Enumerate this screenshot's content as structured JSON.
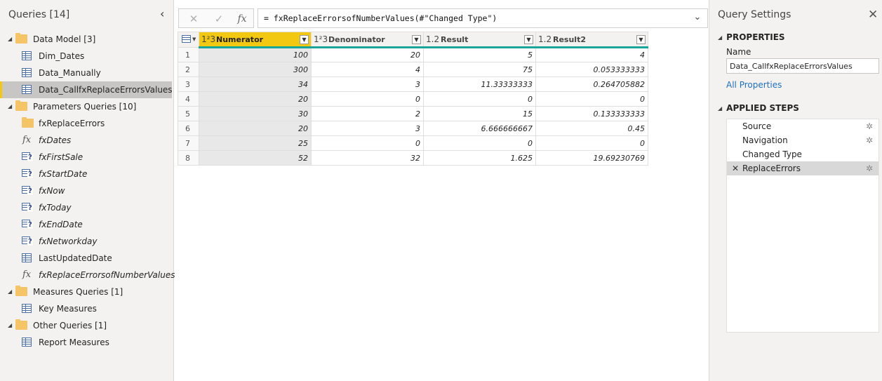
{
  "queries_pane": {
    "title": "Queries [14]",
    "collapse_glyph": "‹",
    "tree": [
      {
        "kind": "group",
        "label": "Data Model [3]"
      },
      {
        "kind": "item",
        "icon": "table-icon",
        "label": "Dim_Dates"
      },
      {
        "kind": "item",
        "icon": "table-icon",
        "label": "Data_Manually"
      },
      {
        "kind": "item",
        "icon": "table-icon",
        "label": "Data_CallfxReplaceErrorsValues",
        "selected": true
      },
      {
        "kind": "group",
        "label": "Parameters Queries [10]"
      },
      {
        "kind": "item",
        "icon": "folder-icon",
        "label": "fxReplaceErrors"
      },
      {
        "kind": "item",
        "icon": "function-icon",
        "label": "fxDates",
        "italic": true
      },
      {
        "kind": "item",
        "icon": "parameter-icon",
        "label": "fxFirstSale",
        "italic": true
      },
      {
        "kind": "item",
        "icon": "parameter-icon",
        "label": "fxStartDate",
        "italic": true
      },
      {
        "kind": "item",
        "icon": "parameter-icon",
        "label": "fxNow",
        "italic": true
      },
      {
        "kind": "item",
        "icon": "parameter-icon",
        "label": "fxToday",
        "italic": true
      },
      {
        "kind": "item",
        "icon": "parameter-icon",
        "label": "fxEndDate",
        "italic": true
      },
      {
        "kind": "item",
        "icon": "parameter-icon",
        "label": "fxNetworkday",
        "italic": true
      },
      {
        "kind": "item",
        "icon": "table-icon",
        "label": "LastUpdatedDate"
      },
      {
        "kind": "item",
        "icon": "function-icon",
        "label": "fxReplaceErrorsofNumberValues",
        "italic": true
      },
      {
        "kind": "group",
        "label": "Measures Queries [1]"
      },
      {
        "kind": "item",
        "icon": "table-icon",
        "label": "Key Measures"
      },
      {
        "kind": "group",
        "label": "Other Queries [1]"
      },
      {
        "kind": "item",
        "icon": "table-icon",
        "label": "Report Measures"
      }
    ]
  },
  "formula_bar": {
    "cancel_glyph": "✕",
    "commit_glyph": "✓",
    "fx_glyph": "fx",
    "formula": "= fxReplaceErrorsofNumberValues(#\"Changed Type\")",
    "expand_glyph": "⌄"
  },
  "grid": {
    "columns": [
      {
        "type": "1²3",
        "name": "Numerator",
        "selected": true
      },
      {
        "type": "1²3",
        "name": "Denominator"
      },
      {
        "type": "1.2",
        "name": "Result"
      },
      {
        "type": "1.2",
        "name": "Result2"
      }
    ],
    "rows": [
      [
        "1",
        "100",
        "20",
        "5",
        "4"
      ],
      [
        "2",
        "300",
        "4",
        "75",
        "0.053333333"
      ],
      [
        "3",
        "34",
        "3",
        "11.33333333",
        "0.264705882"
      ],
      [
        "4",
        "20",
        "0",
        "0",
        "0"
      ],
      [
        "5",
        "30",
        "2",
        "15",
        "0.133333333"
      ],
      [
        "6",
        "20",
        "3",
        "6.666666667",
        "0.45"
      ],
      [
        "7",
        "25",
        "0",
        "0",
        "0"
      ],
      [
        "8",
        "52",
        "32",
        "1.625",
        "19.69230769"
      ]
    ]
  },
  "settings": {
    "title": "Query Settings",
    "close_glyph": "✕",
    "properties_heading": "PROPERTIES",
    "name_label": "Name",
    "name_value": "Data_CallfxReplaceErrorsValues",
    "all_properties": "All Properties",
    "steps_heading": "APPLIED STEPS",
    "steps": [
      {
        "label": "Source",
        "gear": true
      },
      {
        "label": "Navigation",
        "gear": true
      },
      {
        "label": "Changed Type",
        "gear": false
      },
      {
        "label": "ReplaceErrors",
        "gear": true,
        "selected": true
      }
    ]
  },
  "colors": {
    "selected_column": "#f2c811",
    "column_quality_bar": "#1aa59a",
    "folder": "#f5c467",
    "link": "#1f6fbf"
  }
}
